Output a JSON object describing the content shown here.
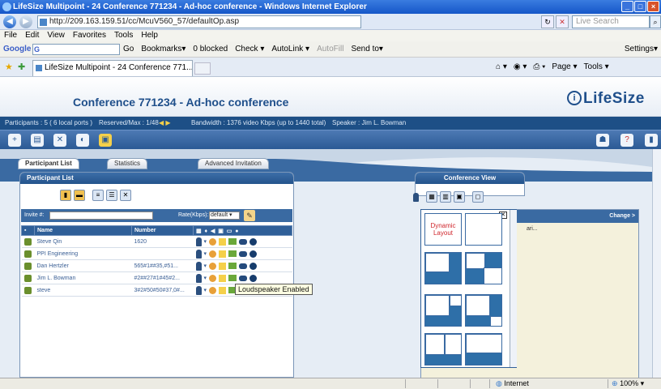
{
  "window": {
    "title": "LifeSize Multipoint - 24 Conference 771234 - Ad-hoc conference - Windows Internet Explorer",
    "controls": [
      "_",
      "□",
      "×"
    ]
  },
  "address_bar": {
    "url": "http://209.163.159.51/cc/McuV560_57/defaultOp.asp",
    "search_placeholder": "Live Search"
  },
  "menu": [
    "File",
    "Edit",
    "View",
    "Favorites",
    "Tools",
    "Help"
  ],
  "google_toolbar": {
    "logo": "Google",
    "search_label": "G",
    "items": [
      "Go",
      "Bookmarks▾",
      "0 blocked",
      "Check ▾",
      "AutoLink ▾",
      "AutoFill",
      "Send to▾"
    ],
    "settings": "Settings▾"
  },
  "browser_tab": {
    "label": "LifeSize Multipoint - 24 Conference 771...",
    "commands": [
      "Page ▾",
      "Tools ▾"
    ]
  },
  "app_header": {
    "conference_title": "Conference 771234 - Ad-hoc conference",
    "brand": "LifeSize"
  },
  "status_strip": {
    "participants": "Participants : 5 ( 6 local ports )",
    "reserved": "Reserved/Max : 1/48",
    "bandwidth": "Bandwidth : 1376 video Kbps (up to 1440 total)",
    "speaker": "Speaker : Jim L. Bowman"
  },
  "tabs": [
    "Participant List",
    "Statistics",
    "Advanced Invitation"
  ],
  "participant_panel": {
    "title": "Participant List",
    "invite_label": "Invite #:",
    "rate_label": "Rate(Kbps):",
    "rate_value": "default",
    "columns": [
      "Name",
      "Number"
    ],
    "rows": [
      {
        "name": "Steve Qin",
        "number": "1620"
      },
      {
        "name": "PPI Engineering",
        "number": ""
      },
      {
        "name": "Dan Hertzler",
        "number": "565#1##35,#51..."
      },
      {
        "name": "Jim L. Bowman",
        "number": "#2##27#1#45#2..."
      },
      {
        "name": "steve",
        "number": "3#2#50#50#37,0#..."
      }
    ]
  },
  "tooltip": "Loudspeaker Enabled",
  "conference_view": {
    "title": "Conference View",
    "column_header": "Change >",
    "cell_value": "ari..."
  },
  "layout_popup": {
    "dynamic_label": "Dynamic Layout"
  },
  "statusbar": {
    "zone": "Internet",
    "zoom": "100%"
  }
}
